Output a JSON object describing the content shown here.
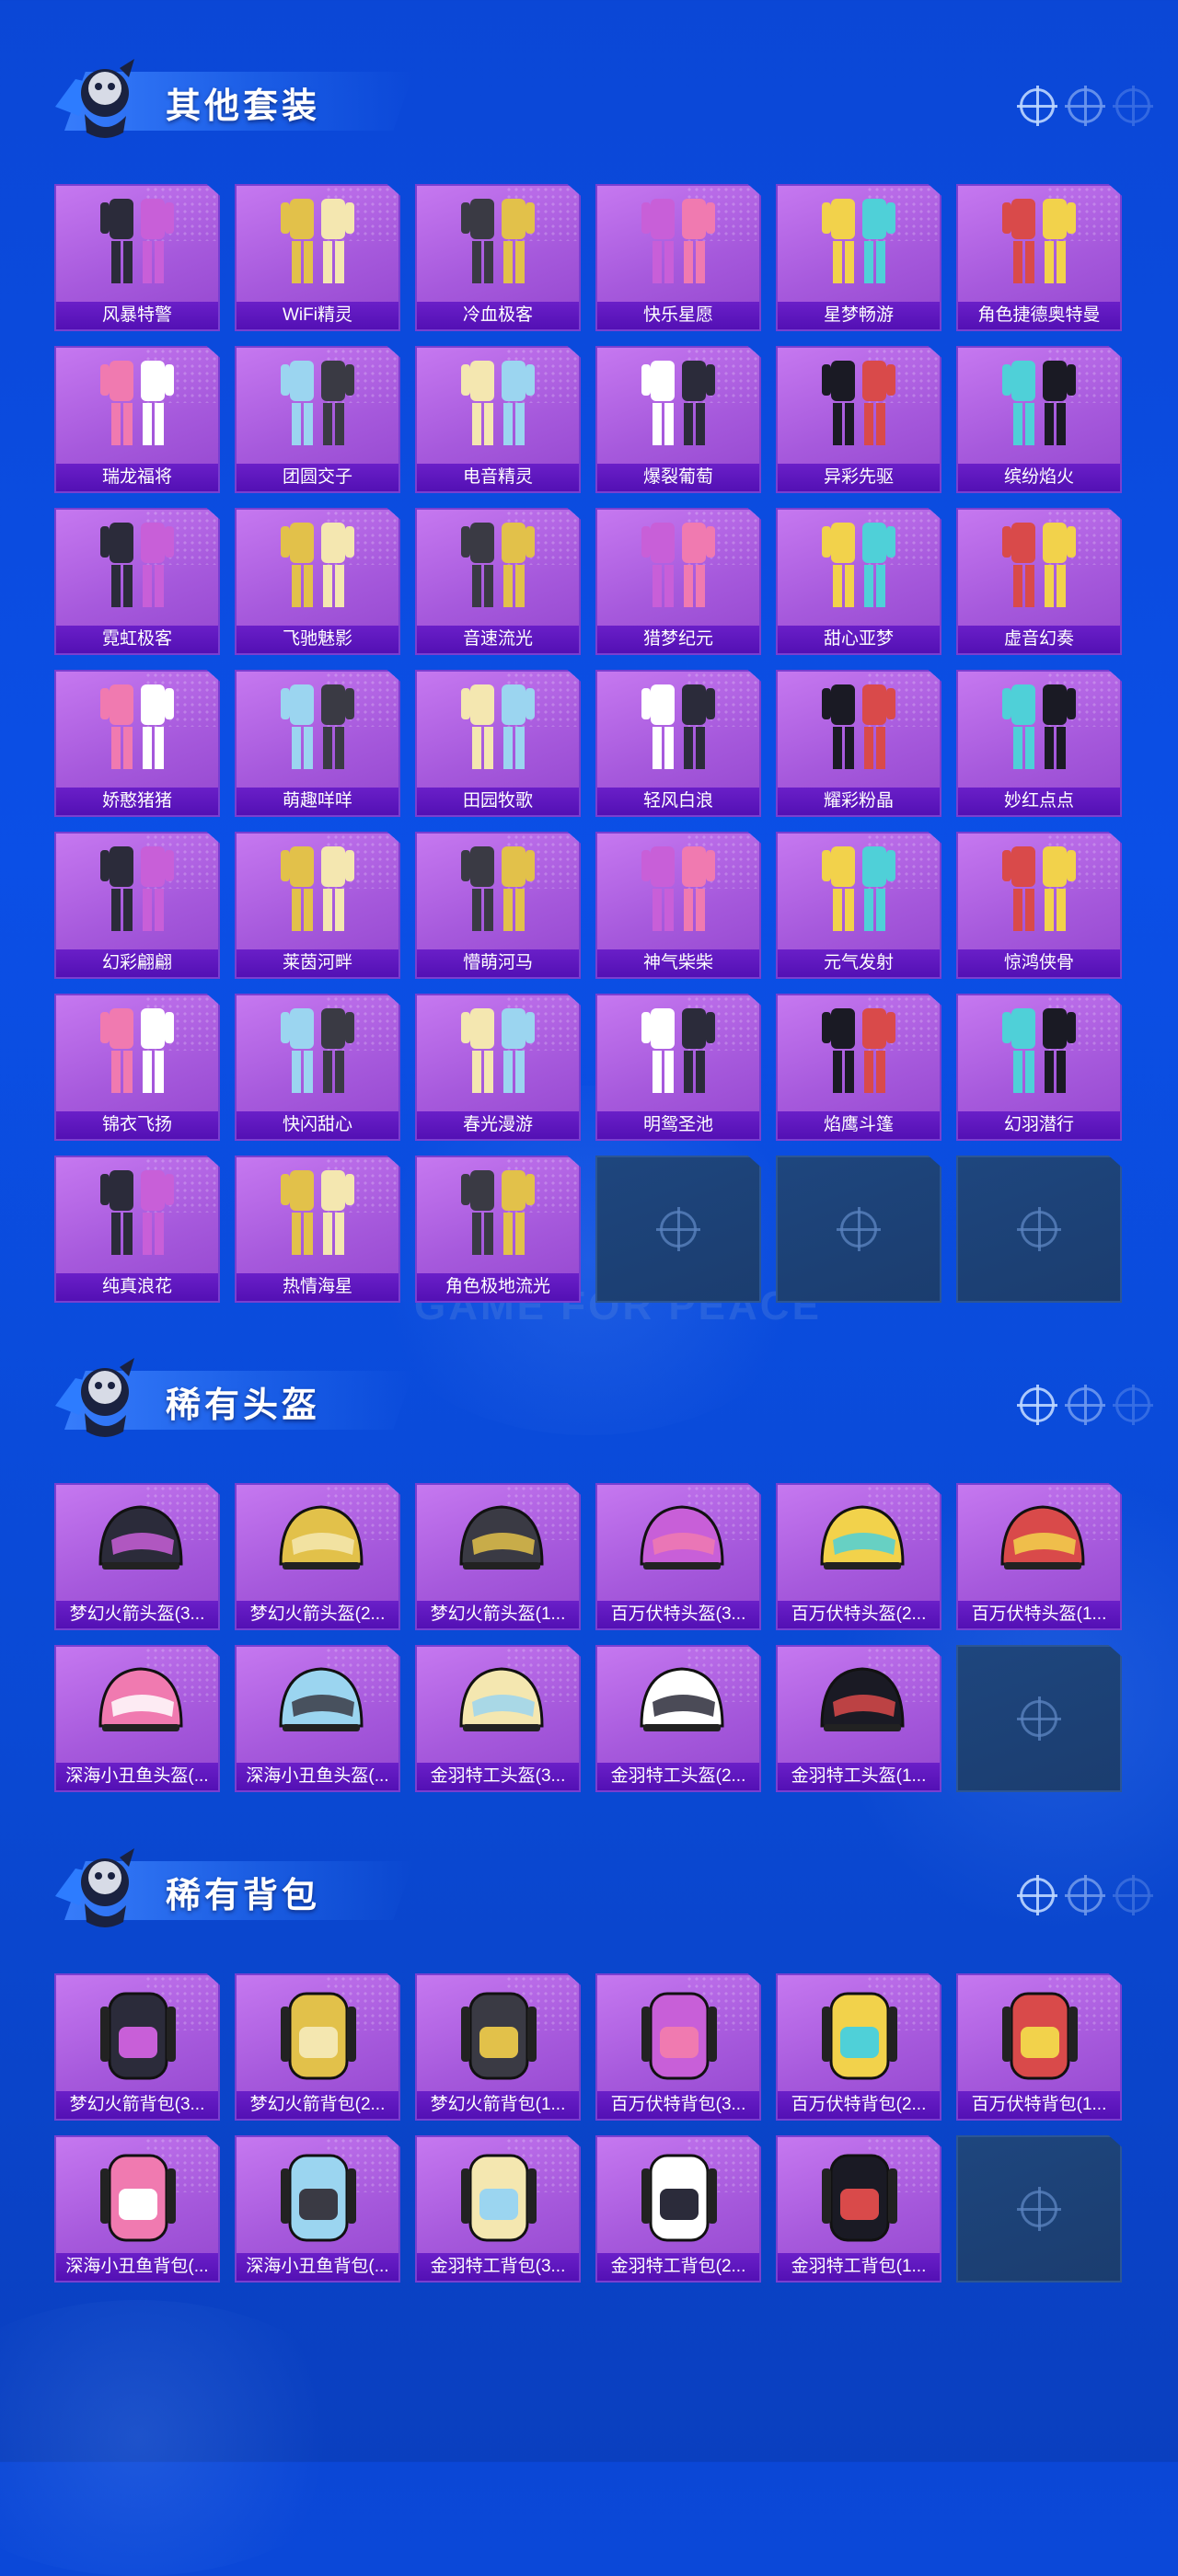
{
  "sections": [
    {
      "title": "其他套装",
      "items": [
        "风暴特警",
        "WiFi精灵",
        "冷血极客",
        "快乐星愿",
        "星梦畅游",
        "角色捷德奥特曼",
        "瑞龙福将",
        "团圆交子",
        "电音精灵",
        "爆裂葡萄",
        "异彩先驱",
        "缤纷焰火",
        "霓虹极客",
        "飞驰魅影",
        "音速流光",
        "猎梦纪元",
        "甜心亚梦",
        "虚音幻奏",
        "娇憨猪猪",
        "萌趣咩咩",
        "田园牧歌",
        "轻风白浪",
        "耀彩粉晶",
        "妙红点点",
        "幻彩翩翩",
        "莱茵河畔",
        "懵萌河马",
        "神气柴柴",
        "元气发射",
        "惊鸿侠骨",
        "锦衣飞扬",
        "快闪甜心",
        "春光漫游",
        "明鸳圣池",
        "焰鹰斗篷",
        "幻羽潜行",
        "纯真浪花",
        "热情海星",
        "角色极地流光"
      ],
      "empty_slots": 3
    },
    {
      "title": "稀有头盔",
      "items": [
        "梦幻火箭头盔(3...",
        "梦幻火箭头盔(2...",
        "梦幻火箭头盔(1...",
        "百万伏特头盔(3...",
        "百万伏特头盔(2...",
        "百万伏特头盔(1...",
        "深海小丑鱼头盔(...",
        "深海小丑鱼头盔(...",
        "金羽特工头盔(3...",
        "金羽特工头盔(2...",
        "金羽特工头盔(1..."
      ],
      "empty_slots": 1
    },
    {
      "title": "稀有背包",
      "items": [
        "梦幻火箭背包(3...",
        "梦幻火箭背包(2...",
        "梦幻火箭背包(1...",
        "百万伏特背包(3...",
        "百万伏特背包(2...",
        "百万伏特背包(1...",
        "深海小丑鱼背包(...",
        "深海小丑鱼背包(...",
        "金羽特工背包(3...",
        "金羽特工背包(2...",
        "金羽特工背包(1..."
      ],
      "empty_slots": 1
    }
  ],
  "watermark": "GAME FOR PEACE",
  "colors": {
    "card": "#a659dc",
    "label_bar": "#5310b4",
    "empty_slot": "#1b3d6f",
    "background": "#0b4fe6"
  }
}
